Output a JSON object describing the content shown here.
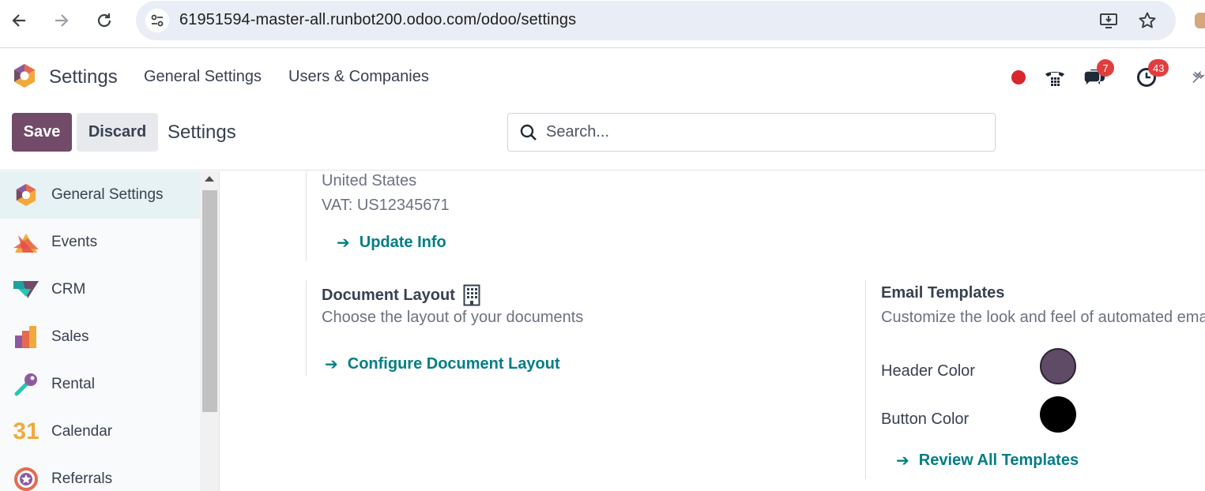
{
  "browser": {
    "url": "61951594-master-all.runbot200.odoo.com/odoo/settings",
    "back_icon": "arrow-left-icon",
    "forward_icon": "arrow-right-icon",
    "reload_icon": "reload-icon",
    "install_icon": "install-app-icon",
    "bookmark_icon": "star-icon"
  },
  "navbar": {
    "app_name": "Settings",
    "menu": [
      "General Settings",
      "Users & Companies"
    ],
    "systray": {
      "messages_badge": "7",
      "activities_badge": "43"
    }
  },
  "control_panel": {
    "save_label": "Save",
    "discard_label": "Discard",
    "title": "Settings",
    "search_placeholder": "Search..."
  },
  "sidebar": {
    "items": [
      {
        "label": "General Settings",
        "icon": "settings-app-icon",
        "active": true
      },
      {
        "label": "Events",
        "icon": "events-app-icon"
      },
      {
        "label": "CRM",
        "icon": "crm-app-icon"
      },
      {
        "label": "Sales",
        "icon": "sales-app-icon"
      },
      {
        "label": "Rental",
        "icon": "rental-app-icon"
      },
      {
        "label": "Calendar",
        "icon": "calendar-app-icon",
        "icon_text": "31"
      },
      {
        "label": "Referrals",
        "icon": "referrals-app-icon"
      }
    ]
  },
  "company": {
    "country": "United States",
    "vat": "VAT:  US12345671",
    "update_info": "Update Info"
  },
  "document_layout": {
    "title": "Document Layout",
    "description": "Choose the layout of your documents",
    "configure_link": "Configure Document Layout"
  },
  "email_templates": {
    "title": "Email Templates",
    "description": "Customize the look and feel of automated emails",
    "header_color_label": "Header Color",
    "header_color": "#5f4b66",
    "button_color_label": "Button Color",
    "button_color": "#000000",
    "review_link": "Review All Templates"
  },
  "colors": {
    "brand": "#714b67",
    "link": "#017e84",
    "badge": "#e03e3e"
  }
}
